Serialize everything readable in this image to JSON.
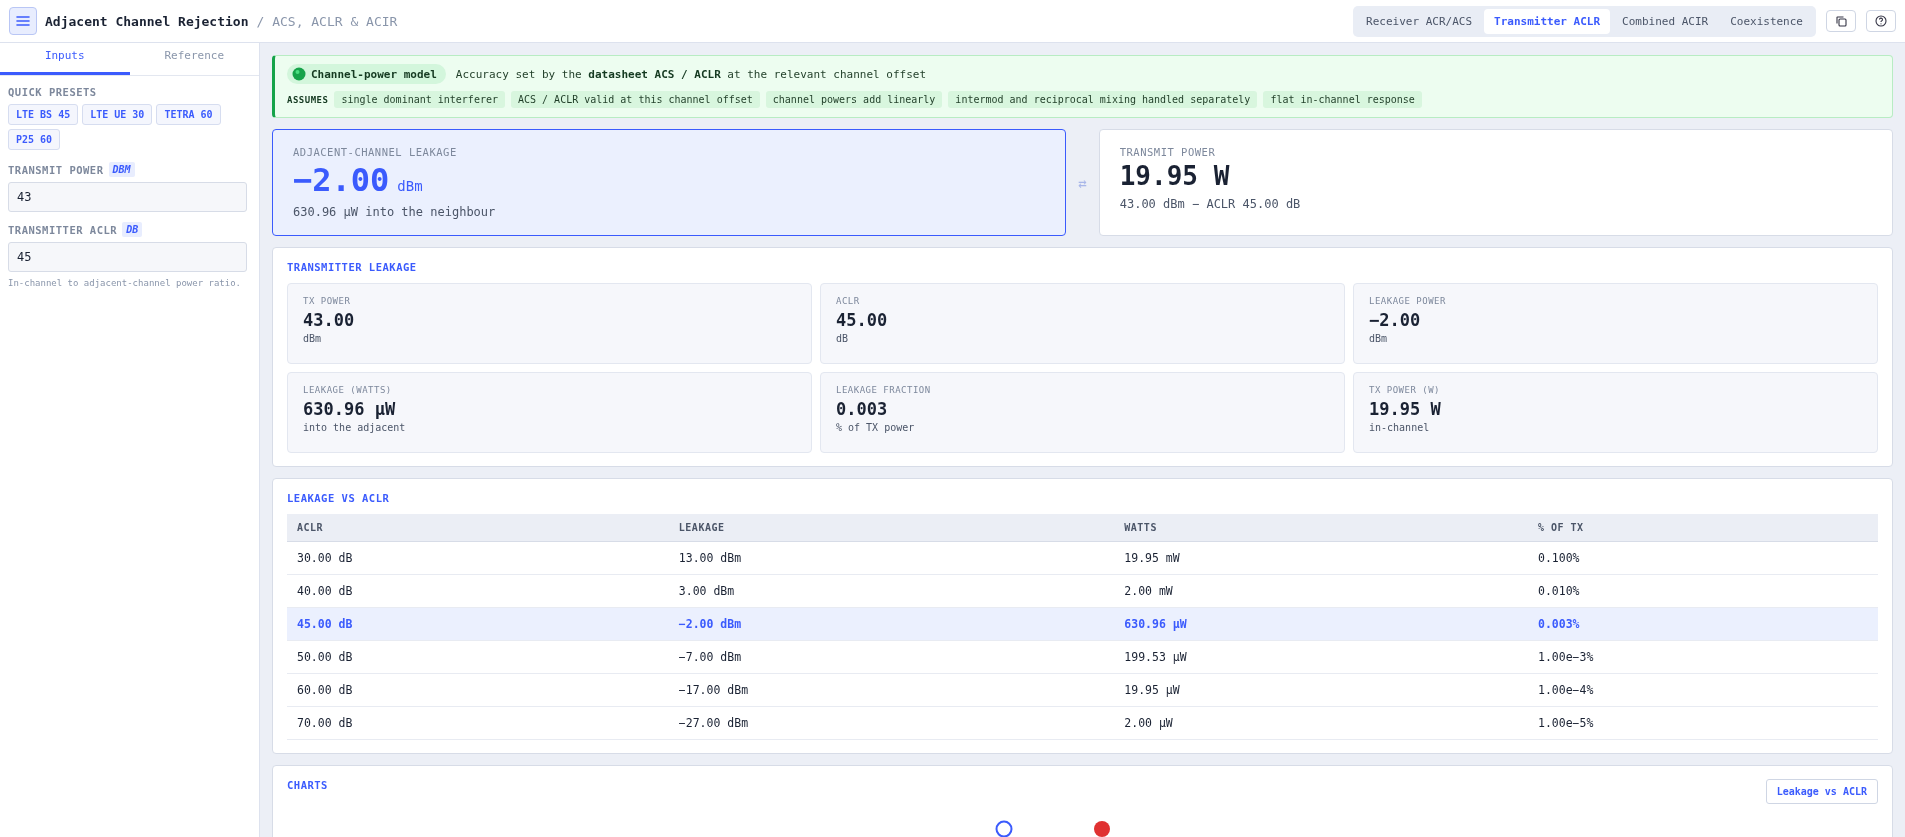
{
  "header": {
    "title": "Adjacent Channel Rejection",
    "subtitle": "/ ACS, ACLR & ACIR",
    "tabs": [
      {
        "label": "Receiver ACR/ACS",
        "selected": false
      },
      {
        "label": "Transmitter ACLR",
        "selected": true
      },
      {
        "label": "Combined ACIR",
        "selected": false
      },
      {
        "label": "Coexistence",
        "selected": false
      }
    ]
  },
  "sidebar": {
    "tabs": [
      {
        "label": "Inputs",
        "selected": true
      },
      {
        "label": "Reference",
        "selected": false
      }
    ],
    "presets_label": "QUICK PRESETS",
    "presets": [
      "LTE BS 45",
      "LTE UE 30",
      "TETRA 60",
      "P25 60"
    ],
    "fields": [
      {
        "label": "TRANSMIT POWER",
        "unit": "DBM",
        "value": "43"
      },
      {
        "label": "TRANSMITTER ACLR",
        "unit": "DB",
        "value": "45",
        "hint": "In-channel to adjacent-channel power ratio."
      }
    ]
  },
  "banner": {
    "model": "Channel-power model",
    "description": "Accuracy set by the **datasheet ACS / ACLR** at the relevant channel offset",
    "assumes_label": "ASSUMES",
    "assumptions": [
      "single dominant interferer",
      "ACS / ACLR valid at this channel offset",
      "channel powers add linearly",
      "intermod and reciprocal mixing handled separately",
      "flat in-channel response"
    ]
  },
  "hero": {
    "swap_glyph": "⇄",
    "cards": [
      {
        "label": "ADJACENT-CHANNEL LEAKAGE",
        "value": "−2.00",
        "unit": "dBm",
        "detail": "630.96 µW into the neighbour",
        "selected": true
      },
      {
        "label": "TRANSMIT POWER",
        "value": "19.95 W",
        "detail": "43.00 dBm − ACLR 45.00 dB",
        "selected": false
      }
    ]
  },
  "leakage": {
    "title": "TRANSMITTER LEAKAGE",
    "tiles": [
      {
        "label": "TX POWER",
        "value": "43.00",
        "unit": "dBm"
      },
      {
        "label": "ACLR",
        "value": "45.00",
        "unit": "dB"
      },
      {
        "label": "LEAKAGE POWER",
        "value": "−2.00",
        "unit": "dBm"
      },
      {
        "label": "LEAKAGE (WATTS)",
        "value": "630.96 µW",
        "unit": "into the adjacent"
      },
      {
        "label": "LEAKAGE FRACTION",
        "value": "0.003",
        "unit": "% of TX power"
      },
      {
        "label": "TX POWER (W)",
        "value": "19.95 W",
        "unit": "in-channel"
      }
    ]
  },
  "table": {
    "title": "LEAKAGE VS ACLR",
    "columns": [
      "ACLR",
      "LEAKAGE",
      "WATTS",
      "% OF TX"
    ],
    "rows": [
      {
        "cells": [
          "30.00 dB",
          "13.00 dBm",
          "19.95 mW",
          "0.100%"
        ],
        "selected": false
      },
      {
        "cells": [
          "40.00 dB",
          "3.00 dBm",
          "2.00 mW",
          "0.010%"
        ],
        "selected": false
      },
      {
        "cells": [
          "45.00 dB",
          "−2.00 dBm",
          "630.96 µW",
          "0.003%"
        ],
        "selected": true
      },
      {
        "cells": [
          "50.00 dB",
          "−7.00 dBm",
          "199.53 µW",
          "1.00e−3%"
        ],
        "selected": false
      },
      {
        "cells": [
          "60.00 dB",
          "−17.00 dBm",
          "19.95 µW",
          "1.00e−4%"
        ],
        "selected": false
      },
      {
        "cells": [
          "70.00 dB",
          "−27.00 dBm",
          "2.00 µW",
          "1.00e−5%"
        ],
        "selected": false
      }
    ]
  },
  "charts": {
    "title": "CHARTS",
    "button": "Leakage vs ACLR"
  }
}
